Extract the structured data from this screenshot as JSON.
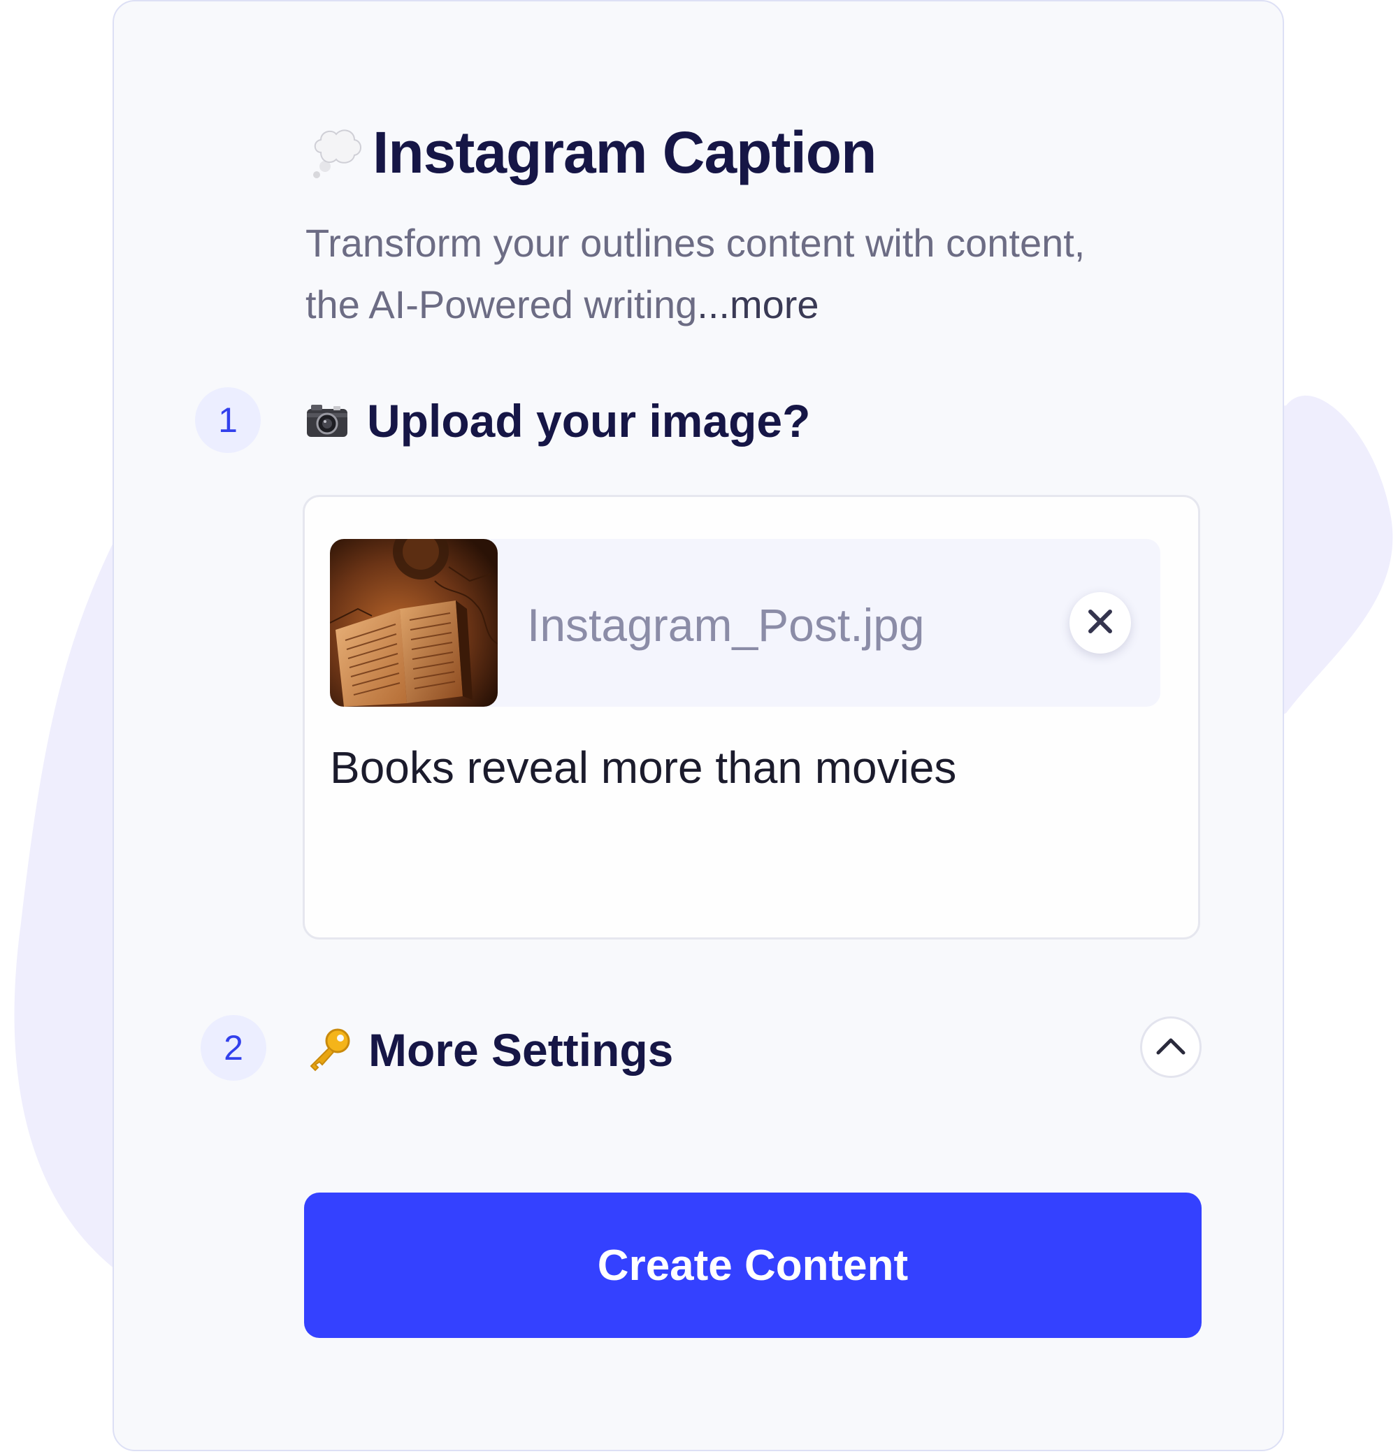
{
  "header": {
    "icon": "thought-bubble-icon",
    "title": "Instagram Caption",
    "subtitle": "Transform your outlines content with content, the AI-Powered writing",
    "more_link": "...more"
  },
  "steps": [
    {
      "number": "1",
      "icon": "camera-icon",
      "title": "Upload your image?"
    },
    {
      "number": "2",
      "icon": "key-icon",
      "title": "More Settings"
    }
  ],
  "upload": {
    "file_name": "Instagram_Post.jpg",
    "thumbnail": "open-book-photo",
    "caption": "Books reveal more than movies"
  },
  "actions": {
    "create_label": "Create Content"
  },
  "colors": {
    "accent": "#3441ff",
    "title": "#161646",
    "badge_bg": "#eceeff",
    "blob": "#efeefd"
  }
}
